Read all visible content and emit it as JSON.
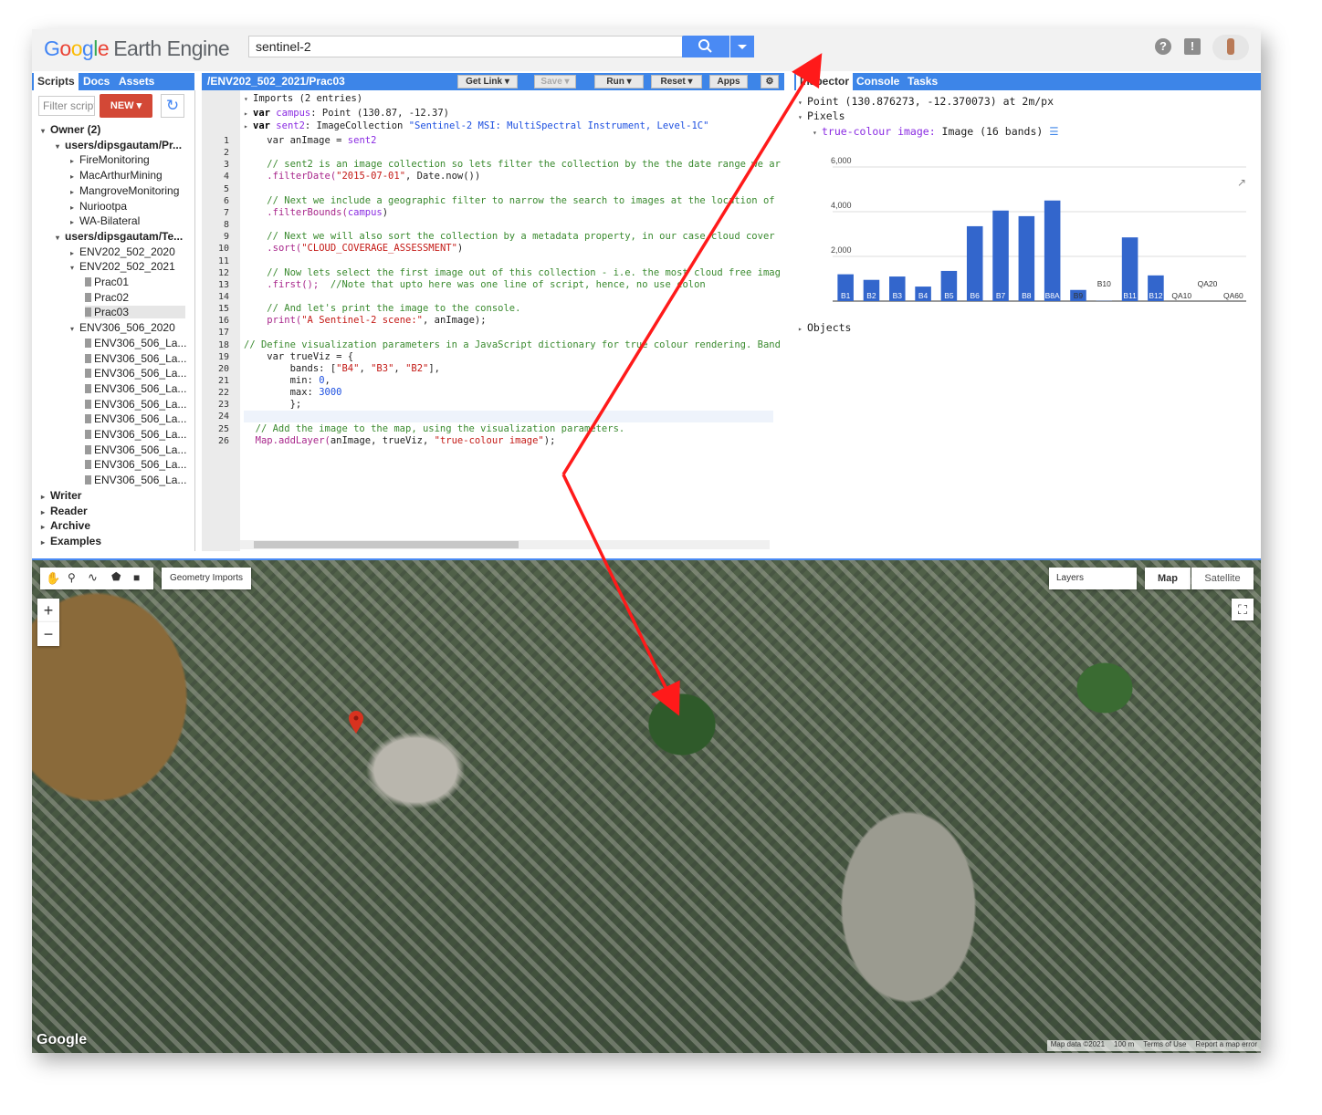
{
  "header": {
    "logo_google": "Google",
    "logo_ee": "Earth Engine",
    "search_value": "sentinel-2"
  },
  "left_tabs": [
    "Scripts",
    "Docs",
    "Assets"
  ],
  "left": {
    "filter_placeholder": "Filter scripts",
    "new_label": "NEW",
    "tree": [
      {
        "label": "Owner (2)",
        "level": 0,
        "kind": "folder-open",
        "bold": true
      },
      {
        "label": "users/dipsgautam/Pr...",
        "level": 1,
        "kind": "folder-open",
        "bold": true
      },
      {
        "label": "FireMonitoring",
        "level": 2,
        "kind": "folder"
      },
      {
        "label": "MacArthurMining",
        "level": 2,
        "kind": "folder"
      },
      {
        "label": "MangroveMonitoring",
        "level": 2,
        "kind": "folder"
      },
      {
        "label": "Nuriootpa",
        "level": 2,
        "kind": "folder"
      },
      {
        "label": "WA-Bilateral",
        "level": 2,
        "kind": "folder"
      },
      {
        "label": "users/dipsgautam/Te...",
        "level": 1,
        "kind": "folder-open",
        "bold": true
      },
      {
        "label": "ENV202_502_2020",
        "level": 2,
        "kind": "folder"
      },
      {
        "label": "ENV202_502_2021",
        "level": 2,
        "kind": "folder-open"
      },
      {
        "label": "Prac01",
        "level": 3,
        "kind": "file"
      },
      {
        "label": "Prac02",
        "level": 3,
        "kind": "file"
      },
      {
        "label": "Prac03",
        "level": 3,
        "kind": "file-selected"
      },
      {
        "label": "ENV306_506_2020",
        "level": 2,
        "kind": "folder-open"
      },
      {
        "label": "ENV306_506_La...",
        "level": 3,
        "kind": "file"
      },
      {
        "label": "ENV306_506_La...",
        "level": 3,
        "kind": "file"
      },
      {
        "label": "ENV306_506_La...",
        "level": 3,
        "kind": "file"
      },
      {
        "label": "ENV306_506_La...",
        "level": 3,
        "kind": "file"
      },
      {
        "label": "ENV306_506_La...",
        "level": 3,
        "kind": "file"
      },
      {
        "label": "ENV306_506_La...",
        "level": 3,
        "kind": "file"
      },
      {
        "label": "ENV306_506_La...",
        "level": 3,
        "kind": "file"
      },
      {
        "label": "ENV306_506_La...",
        "level": 3,
        "kind": "file"
      },
      {
        "label": "ENV306_506_La...",
        "level": 3,
        "kind": "file"
      },
      {
        "label": "ENV306_506_La...",
        "level": 3,
        "kind": "file"
      },
      {
        "label": "Writer",
        "level": 0,
        "kind": "folder",
        "bold": true
      },
      {
        "label": "Reader",
        "level": 0,
        "kind": "folder",
        "bold": true
      },
      {
        "label": "Archive",
        "level": 0,
        "kind": "folder",
        "bold": true
      },
      {
        "label": "Examples",
        "level": 0,
        "kind": "folder",
        "bold": true
      }
    ]
  },
  "editor": {
    "path": "/ENV202_502_2021/Prac03",
    "buttons": [
      "Get Link",
      "Save",
      "Run",
      "Reset",
      "Apps"
    ],
    "imports_header": "Imports (2 entries)",
    "import1": {
      "kw": "var",
      "name": "campus",
      "rest": " Point (130.87, -12.37)"
    },
    "import2": {
      "kw": "var",
      "name": "sent2",
      "type": " ImageCollection ",
      "value": "\"Sentinel-2 MSI: MultiSpectral Instrument, Level-1C\""
    },
    "lines": [
      {
        "n": "1",
        "t": [
          [
            "",
            "    var anImage = "
          ],
          [
            "vr",
            "sent2"
          ]
        ]
      },
      {
        "n": "2",
        "t": []
      },
      {
        "n": "3",
        "t": [
          [
            "cm",
            "    // sent2 is an image collection so lets filter the collection by the the date range we ar"
          ]
        ]
      },
      {
        "n": "4",
        "t": [
          [
            "",
            "    "
          ],
          [
            "fn",
            ".filterDate("
          ],
          [
            "st",
            "\"2015-07-01\""
          ],
          [
            "",
            ", Date.now())"
          ]
        ]
      },
      {
        "n": "5",
        "t": []
      },
      {
        "n": "6",
        "t": [
          [
            "cm",
            "    // Next we include a geographic filter to narrow the search to images at the location of"
          ]
        ]
      },
      {
        "n": "7",
        "t": [
          [
            "",
            "    "
          ],
          [
            "fn",
            ".filterBounds("
          ],
          [
            "vr",
            "campus"
          ],
          [
            "",
            ")"
          ]
        ]
      },
      {
        "n": "8",
        "t": []
      },
      {
        "n": "9",
        "t": [
          [
            "cm",
            "    // Next we will also sort the collection by a metadata property, in our case cloud cover"
          ]
        ]
      },
      {
        "n": "10",
        "t": [
          [
            "",
            "    "
          ],
          [
            "fn",
            ".sort("
          ],
          [
            "st",
            "\"CLOUD_COVERAGE_ASSESSMENT\""
          ],
          [
            "",
            ")"
          ]
        ]
      },
      {
        "n": "11",
        "t": []
      },
      {
        "n": "12",
        "t": [
          [
            "cm",
            "    // Now lets select the first image out of this collection - i.e. the most cloud free imag"
          ]
        ]
      },
      {
        "n": "13",
        "t": [
          [
            "",
            "    "
          ],
          [
            "fn",
            ".first();"
          ],
          [
            "cm",
            "  //Note that upto here was one line of script, hence, no use colon"
          ]
        ]
      },
      {
        "n": "14",
        "t": []
      },
      {
        "n": "15",
        "t": [
          [
            "cm",
            "    // And let's print the image to the console."
          ]
        ]
      },
      {
        "n": "16",
        "t": [
          [
            "",
            "    "
          ],
          [
            "fn",
            "print("
          ],
          [
            "st",
            "\"A Sentinel-2 scene:\""
          ],
          [
            "",
            ", anImage);"
          ]
        ]
      },
      {
        "n": "17",
        "t": []
      },
      {
        "n": "18",
        "t": [
          [
            "cm",
            "// Define visualization parameters in a JavaScript dictionary for true colour rendering. Band"
          ]
        ]
      },
      {
        "n": "19",
        "t": [
          [
            "",
            "    var trueViz = {"
          ]
        ]
      },
      {
        "n": "20",
        "t": [
          [
            "",
            "        bands: ["
          ],
          [
            "st",
            "\"B4\""
          ],
          [
            "",
            ", "
          ],
          [
            "st",
            "\"B3\""
          ],
          [
            "",
            ", "
          ],
          [
            "st",
            "\"B2\""
          ],
          [
            "",
            "],"
          ]
        ]
      },
      {
        "n": "21",
        "t": [
          [
            "",
            "        min: "
          ],
          [
            "nm",
            "0"
          ],
          [
            "",
            ","
          ]
        ]
      },
      {
        "n": "22",
        "t": [
          [
            "",
            "        max: "
          ],
          [
            "nm",
            "3000"
          ]
        ]
      },
      {
        "n": "23",
        "t": [
          [
            "",
            "        };"
          ]
        ]
      },
      {
        "n": "24",
        "t": []
      },
      {
        "n": "25",
        "t": [
          [
            "cm",
            "  // Add the image to the map, using the visualization parameters."
          ]
        ]
      },
      {
        "n": "26",
        "t": [
          [
            "",
            "  "
          ],
          [
            "fn",
            "Map.addLayer("
          ],
          [
            "",
            "anImage, trueViz, "
          ],
          [
            "st",
            "\"true-colour image\""
          ],
          [
            "",
            ");"
          ]
        ]
      }
    ]
  },
  "right_tabs": [
    "Inspector",
    "Console",
    "Tasks"
  ],
  "inspector": {
    "point": "Point (130.876273, -12.370073) at 2m/px",
    "pixels": "Pixels",
    "layer_name": "true-colour image:",
    "layer_type": " Image (16 bands)",
    "objects": "Objects"
  },
  "chart_data": {
    "type": "bar",
    "categories": [
      "B1",
      "B2",
      "B3",
      "B4",
      "B5",
      "B6",
      "B7",
      "B8",
      "B8A",
      "B9",
      "B10",
      "B11",
      "B12",
      "QA10",
      "QA20",
      "QA60"
    ],
    "values": [
      1200,
      950,
      1100,
      650,
      1350,
      3350,
      4050,
      3800,
      4500,
      500,
      10,
      2850,
      1150,
      0,
      0,
      0
    ],
    "ylim": [
      0,
      6000
    ],
    "yticks": [
      "2,000",
      "4,000",
      "6,000"
    ],
    "color": "#3366cc"
  },
  "map": {
    "geometry_imports": "Geometry Imports",
    "layers": "Layers",
    "map_btn": "Map",
    "satellite_btn": "Satellite",
    "zoom_in": "+",
    "zoom_out": "−",
    "attrib": [
      "Map data ©2021",
      "100 m",
      "Terms of Use",
      "Report a map error"
    ],
    "google": "Google"
  }
}
